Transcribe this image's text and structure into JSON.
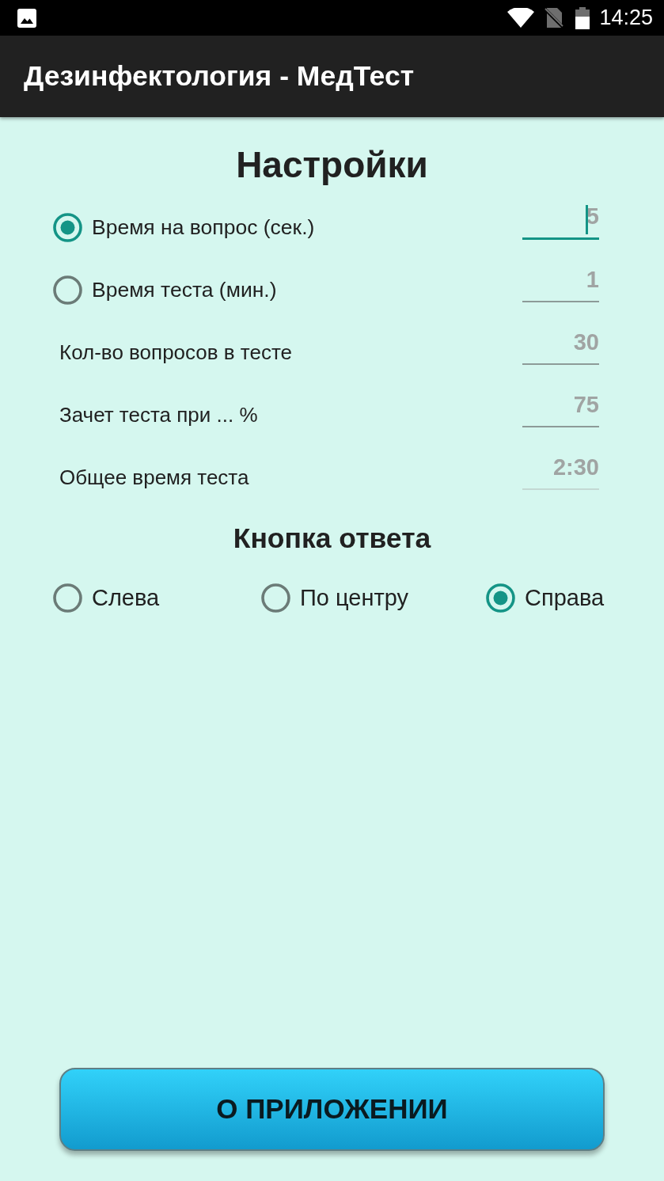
{
  "status_bar": {
    "time": "14:25"
  },
  "app_bar": {
    "title": "Дезинфектология - МедТест"
  },
  "settings": {
    "title": "Настройки",
    "rows": [
      {
        "kind": "radio",
        "label": "Время на вопрос (сек.)",
        "selected": true,
        "field": {
          "placeholder": "5",
          "focused": true,
          "disabled": false
        }
      },
      {
        "kind": "radio",
        "label": "Время теста (мин.)",
        "selected": false,
        "field": {
          "placeholder": "1",
          "focused": false,
          "disabled": false
        }
      },
      {
        "kind": "plain",
        "label": "Кол-во вопросов в тесте",
        "field": {
          "placeholder": "30",
          "focused": false,
          "disabled": false
        }
      },
      {
        "kind": "plain",
        "label": "Зачет теста при ... %",
        "field": {
          "placeholder": "75",
          "focused": false,
          "disabled": false
        }
      },
      {
        "kind": "plain",
        "label": "Общее время теста",
        "field": {
          "placeholder": "2:30",
          "focused": false,
          "disabled": true
        }
      }
    ]
  },
  "answer_button": {
    "title": "Кнопка ответа",
    "options": [
      {
        "label": "Слева",
        "selected": false
      },
      {
        "label": "По центру",
        "selected": false
      },
      {
        "label": "Справа",
        "selected": true
      }
    ]
  },
  "about_button": {
    "label": "О ПРИЛОЖЕНИИ"
  }
}
